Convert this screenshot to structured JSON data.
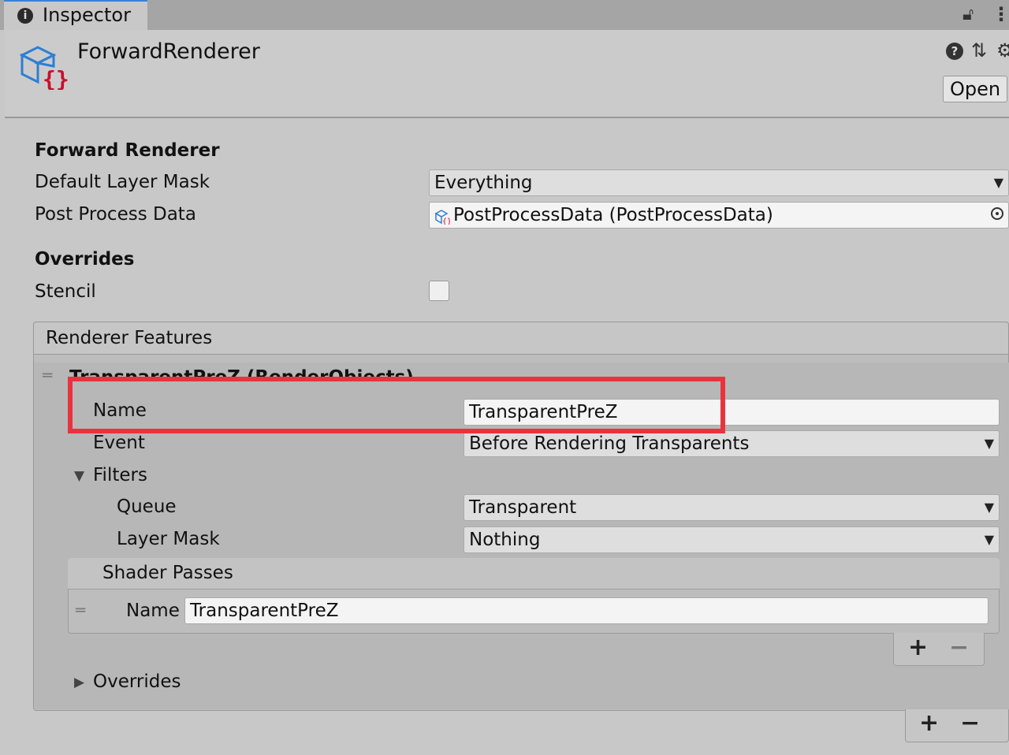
{
  "tab": {
    "label": "Inspector",
    "icon": "info-icon"
  },
  "header": {
    "title": "ForwardRenderer",
    "open_label": "Open",
    "icons": [
      "help-icon",
      "presets-icon",
      "gear-icon",
      "lock-icon",
      "menu-icon"
    ]
  },
  "forward_renderer": {
    "section_title": "Forward Renderer",
    "default_layer_mask_label": "Default Layer Mask",
    "default_layer_mask_value": "Everything",
    "post_process_data_label": "Post Process Data",
    "post_process_data_value": "PostProcessData (PostProcessData)"
  },
  "overrides": {
    "section_title": "Overrides",
    "stencil_label": "Stencil",
    "stencil_checked": false
  },
  "renderer_features": {
    "header": "Renderer Features",
    "feature": {
      "title": "TransparentPreZ (RenderObjects)",
      "name_label": "Name",
      "name_value": "TransparentPreZ",
      "event_label": "Event",
      "event_value": "Before Rendering Transparents",
      "filters_label": "Filters",
      "queue_label": "Queue",
      "queue_value": "Transparent",
      "layer_mask_label": "Layer Mask",
      "layer_mask_value": "Nothing",
      "shader_passes_label": "Shader Passes",
      "shader_pass_name_label": "Name",
      "shader_pass_name_value": "TransparentPreZ",
      "overrides_label": "Overrides"
    },
    "add_label": "+",
    "remove_label": "−"
  },
  "colors": {
    "highlight": "#e8333f",
    "accent": "#3a7fd5"
  }
}
